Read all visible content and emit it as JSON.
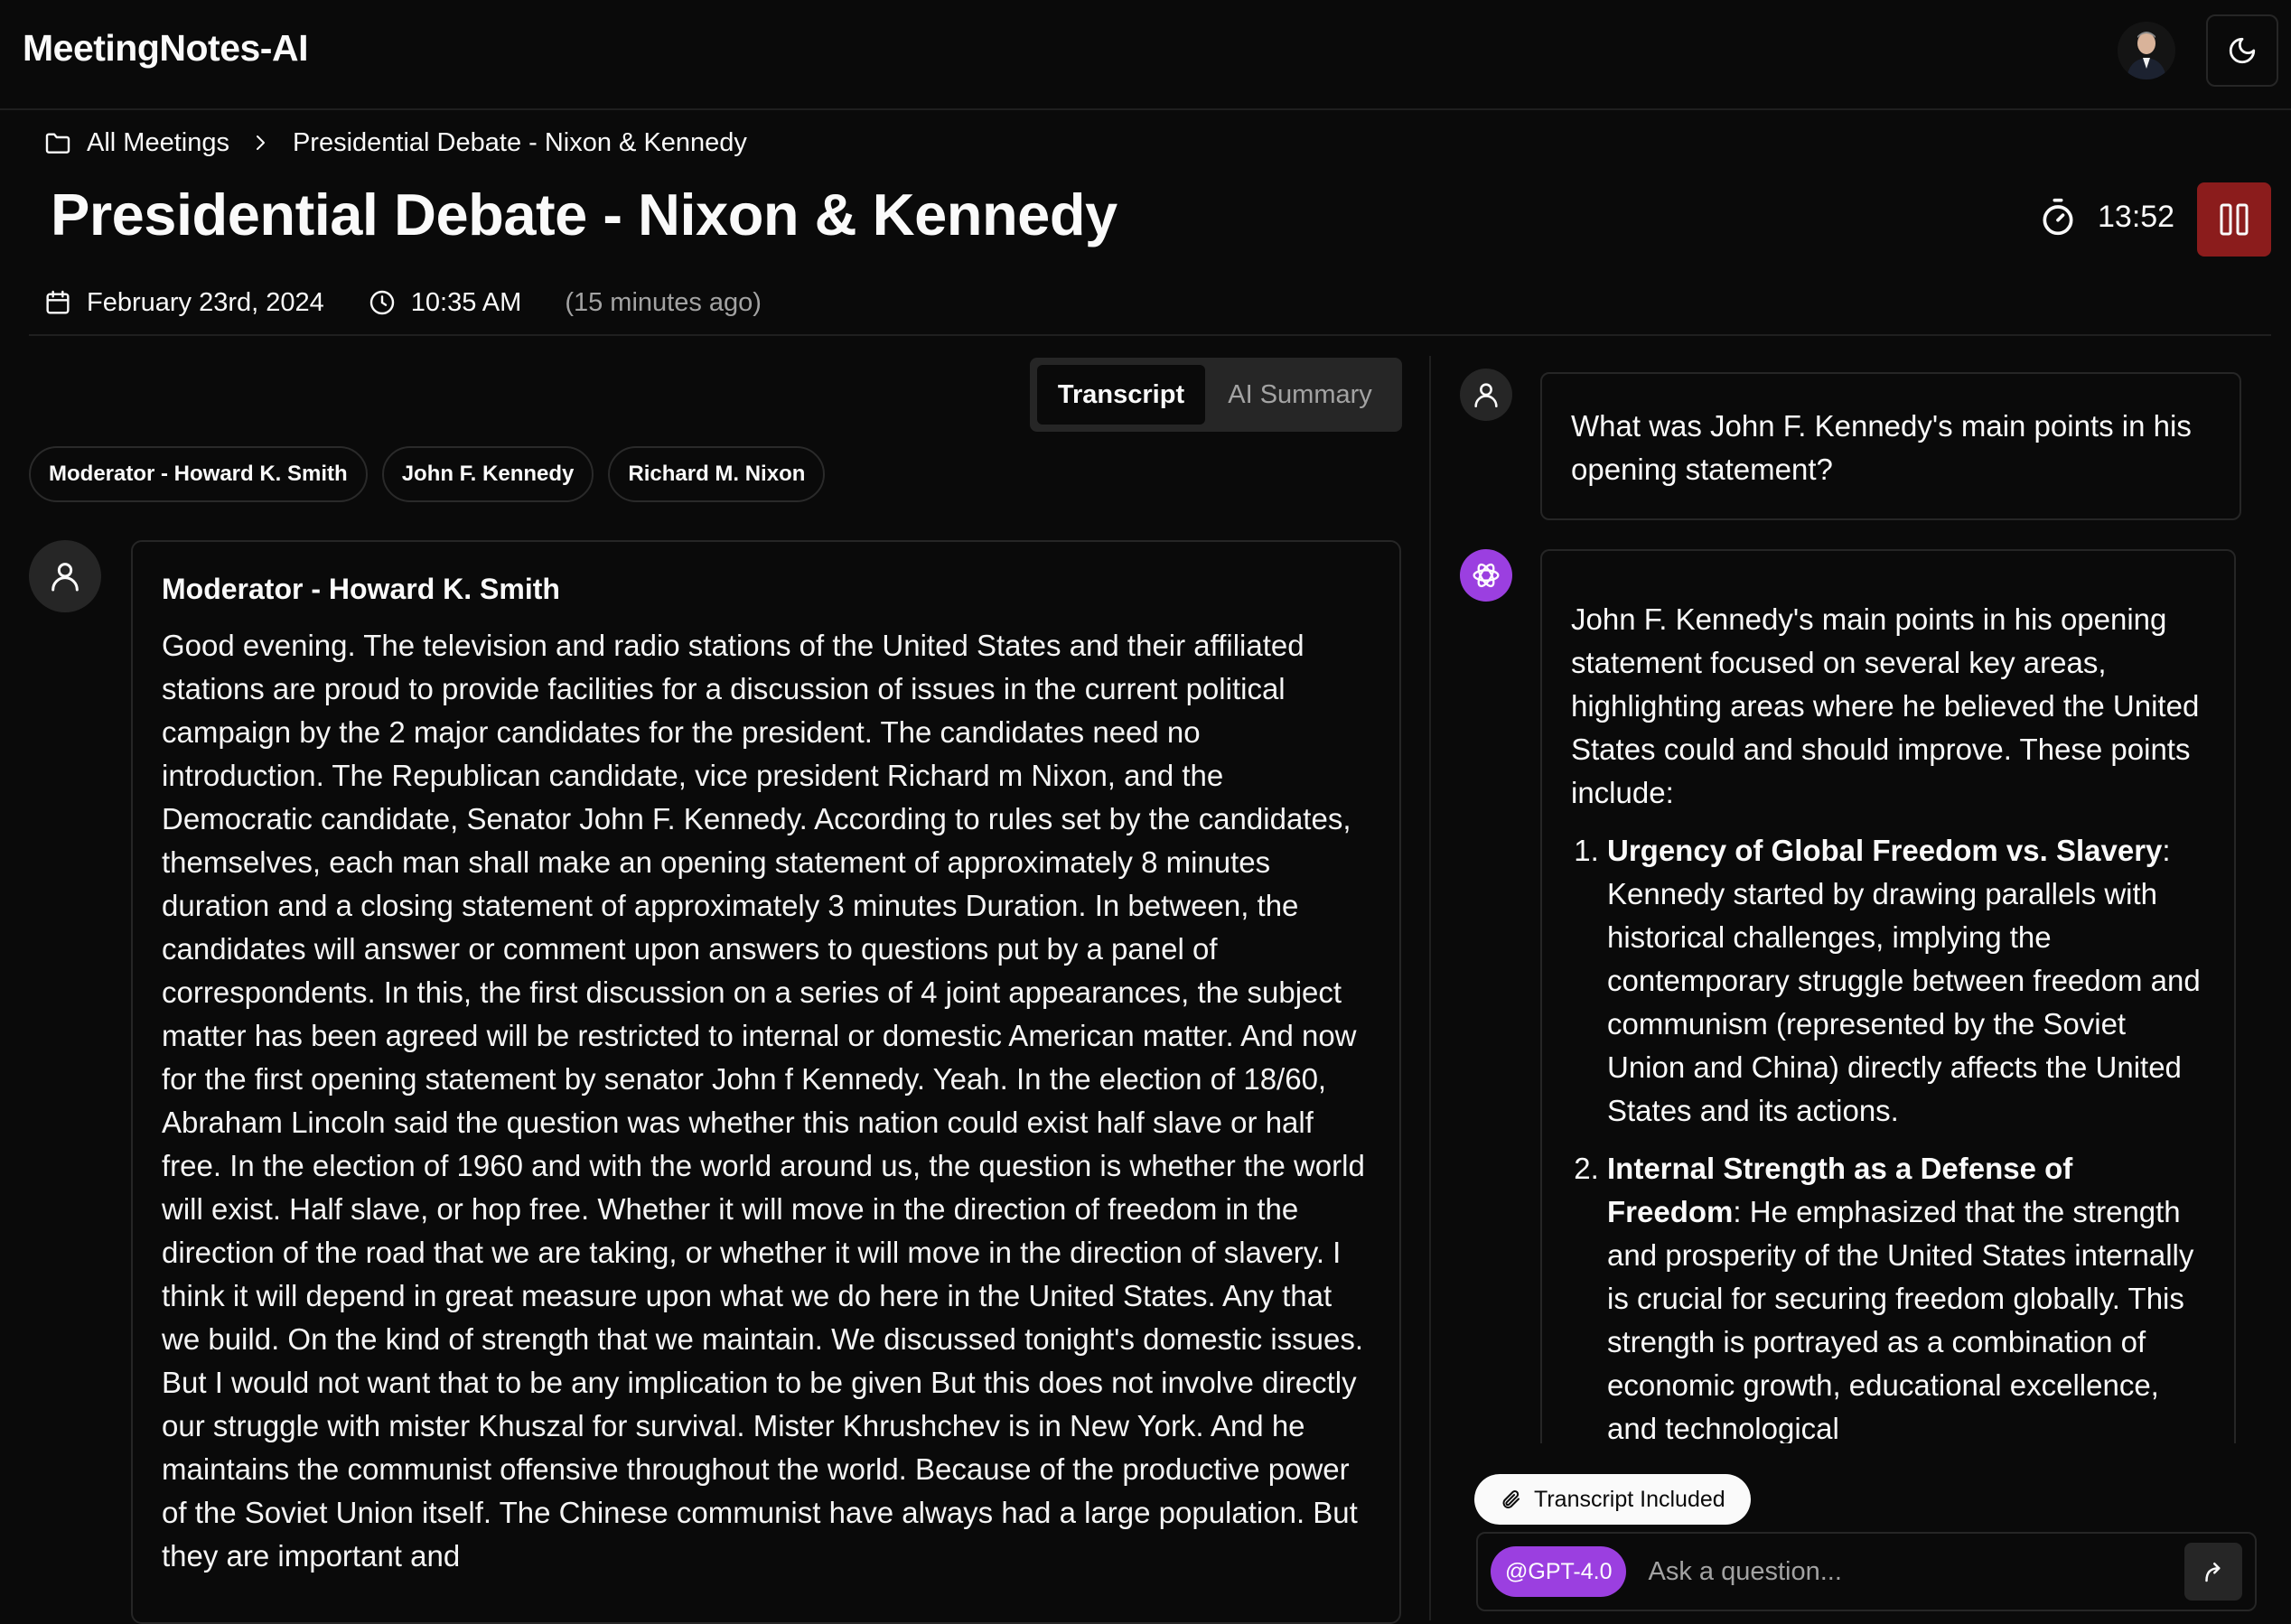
{
  "app": {
    "title": "MeetingNotes-AI"
  },
  "breadcrumb": {
    "root": "All Meetings",
    "current": "Presidential Debate - Nixon & Kennedy"
  },
  "meeting": {
    "title": "Presidential Debate - Nixon & Kennedy",
    "date": "February 23rd, 2024",
    "time": "10:35 AM",
    "relative": "(15 minutes ago)",
    "timer": "13:52"
  },
  "tabs": [
    {
      "label": "Transcript",
      "active": true
    },
    {
      "label": "AI Summary",
      "active": false
    }
  ],
  "speakers": [
    "Moderator - Howard K. Smith",
    "John F. Kennedy",
    "Richard M. Nixon"
  ],
  "transcript": {
    "speaker": "Moderator - Howard K. Smith",
    "text": "Good evening. The television and radio stations of the United States and their affiliated stations are proud to provide facilities for a discussion of issues in the current political campaign by the 2 major candidates for the president. The candidates need no introduction. The Republican candidate, vice president Richard m Nixon, and the Democratic candidate, Senator John F. Kennedy. According to rules set by the candidates, themselves, each man shall make an opening statement of approximately 8 minutes duration and a closing statement of approximately 3 minutes Duration. In between, the candidates will answer or comment upon answers to questions put by a panel of correspondents. In this, the first discussion on a series of 4 joint appearances, the subject matter has been agreed will be restricted to internal or domestic American matter. And now for the first opening statement by senator John f Kennedy. Yeah. In the election of 18/60, Abraham Lincoln said the question was whether this nation could exist half slave or half free. In the election of 1960 and with the world around us, the question is whether the world will exist. Half slave, or hop free. Whether it will move in the direction of freedom in the direction of the road that we are taking, or whether it will move in the direction of slavery. I think it will depend in great measure upon what we do here in the United States. Any that we build. On the kind of strength that we maintain. We discussed tonight's domestic issues. But I would not want that to be any implication to be given But this does not involve directly our struggle with mister Khuszal for survival. Mister Khrushchev is in New York. And he maintains the communist offensive throughout the world. Because of the productive power of the Soviet Union itself. The Chinese communist have always had a large population. But they are important and"
  },
  "chat": {
    "question": "What was John F. Kennedy's main points in his opening statement?",
    "answer_intro": "John F. Kennedy's main points in his opening statement focused on several key areas, highlighting areas where he believed the United States could and should improve. These points include:",
    "points": [
      {
        "title": "Urgency of Global Freedom vs. Slavery",
        "text": ": Kennedy started by drawing parallels with historical challenges, implying the contemporary struggle between freedom and communism (represented by the Soviet Union and China) directly affects the United States and its actions."
      },
      {
        "title": "Internal Strength as a Defense of Freedom",
        "text": ": He emphasized that the strength and prosperity of the United States internally is crucial for securing freedom globally. This strength is portrayed as a combination of economic growth, educational excellence, and technological"
      }
    ],
    "included_label": "Transcript Included",
    "model": "@GPT-4.0",
    "placeholder": "Ask a question..."
  },
  "colors": {
    "background": "#0a0a0a",
    "accent_purple": "#9b3fe0",
    "pause_red": "#8b1c1c",
    "border": "#262626"
  },
  "icons": [
    "avatar-photo",
    "moon-icon",
    "folder-icon",
    "chevron-right-icon",
    "stopwatch-icon",
    "pause-icon",
    "calendar-icon",
    "clock-icon",
    "user-icon",
    "openai-icon",
    "paperclip-icon",
    "send-icon"
  ]
}
